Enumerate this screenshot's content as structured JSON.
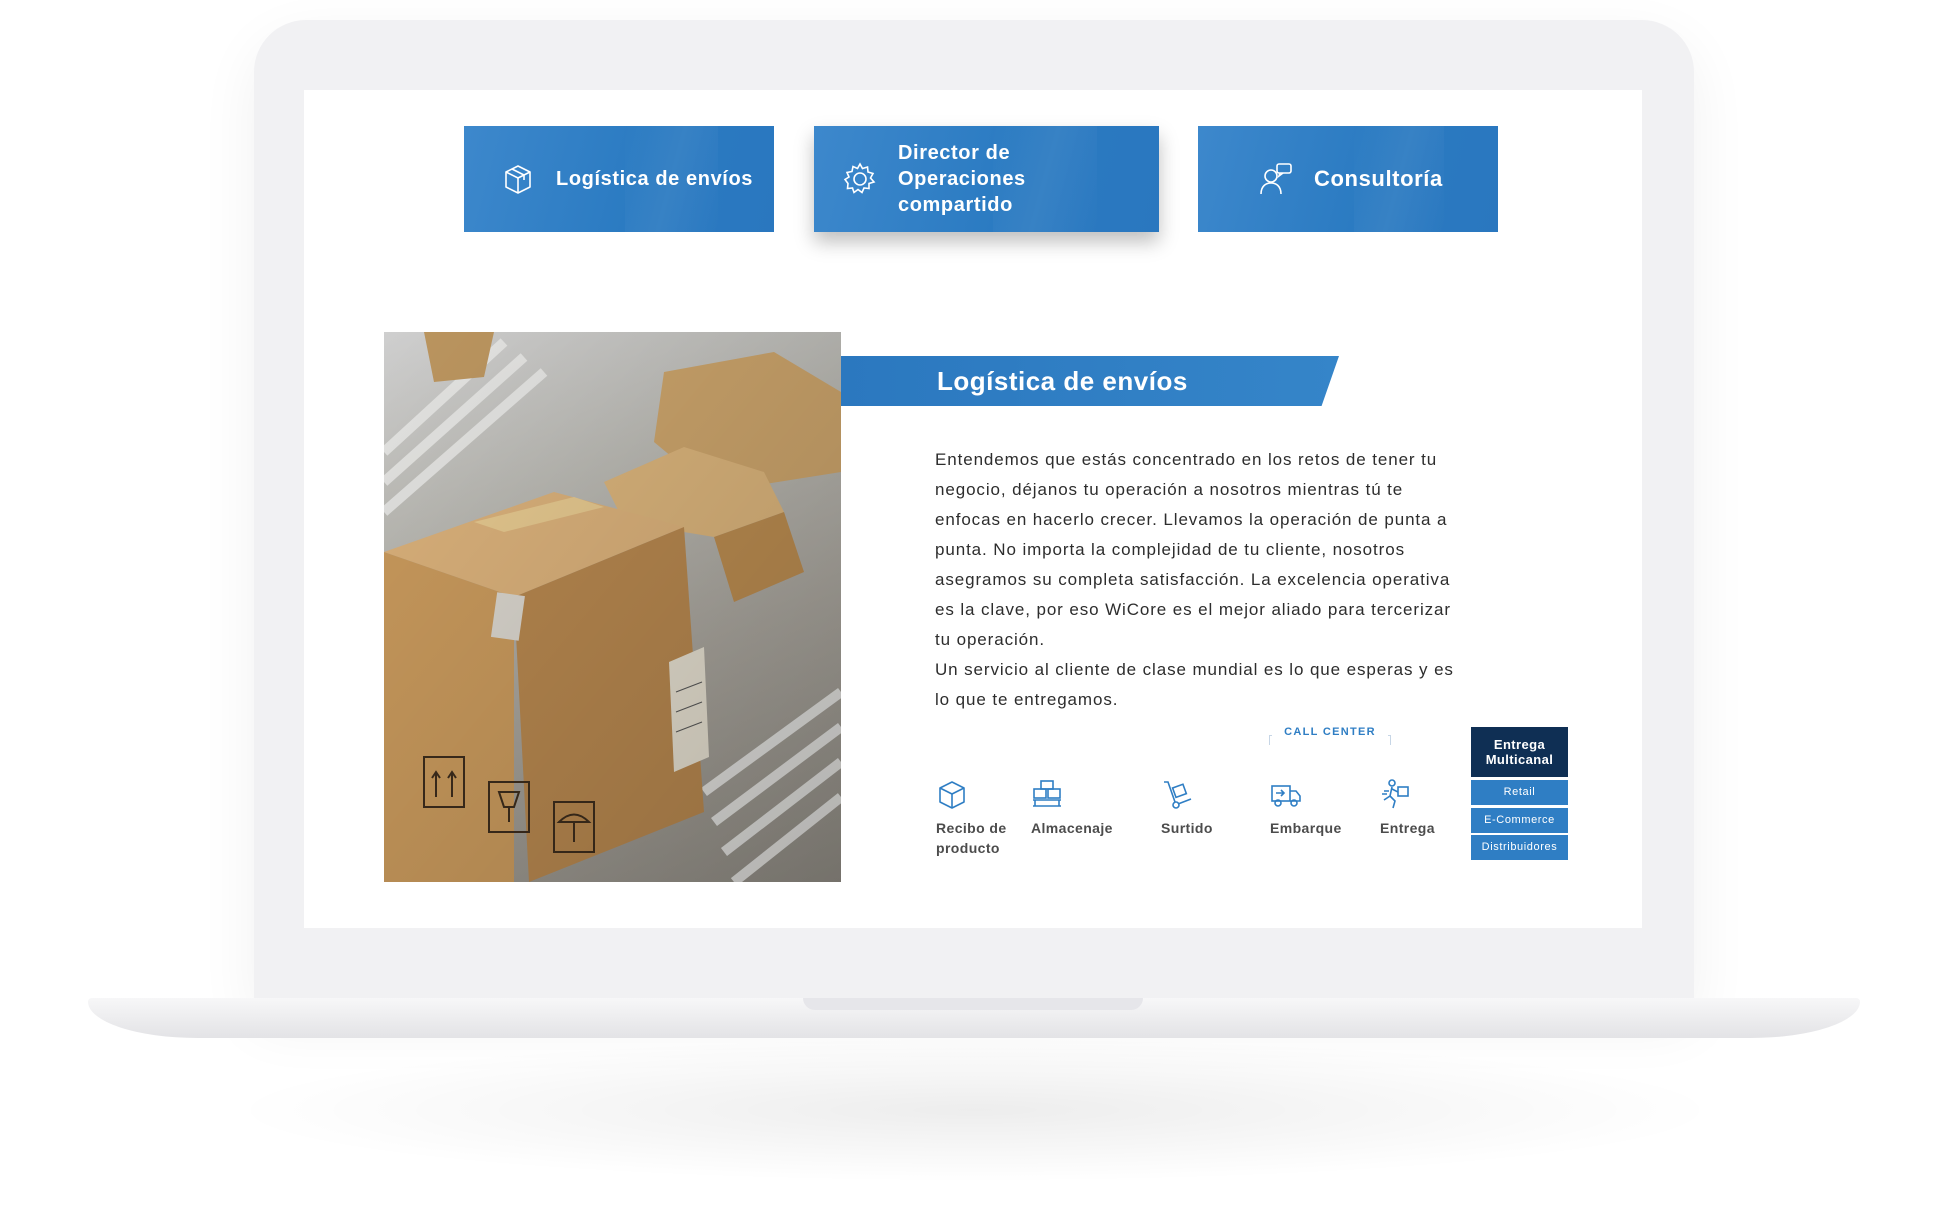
{
  "colors": {
    "tab_blue": "#2b7bc2",
    "dark_navy": "#0f2f54",
    "icon_blue": "#2f7ec4",
    "text": "#2d2d2d"
  },
  "tabs": [
    {
      "label": "Logística de envíos",
      "icon": "box-icon",
      "active": false
    },
    {
      "label": "Director de Operaciones compartido",
      "icon": "gear-icon",
      "active": true
    },
    {
      "label": "Consultoría",
      "icon": "consultant-icon",
      "active": false
    }
  ],
  "section": {
    "title": "Logística de envíos",
    "photo": "cardboard-boxes-on-conveyor",
    "paragraphs": [
      "Entendemos que estás concentrado en los retos de tener tu negocio, déjanos tu operación a nosotros mientras tú te enfocas en hacerlo crecer. Llevamos la operación de punta a punta. No importa la complejidad de tu cliente, nosotros asegramos su completa satisfacción. La excelencia operativa es la clave, por eso WiCore es el mejor aliado para tercerizar tu operación.",
      "Un servicio al cliente de clase mundial es lo que esperas y es lo que te entregamos."
    ]
  },
  "call_center": {
    "label": "CALL CENTER"
  },
  "steps": [
    {
      "label": "Recibo de producto",
      "icon": "box-icon"
    },
    {
      "label": "Almacenaje",
      "icon": "warehouse-icon"
    },
    {
      "label": "Surtido",
      "icon": "hand-truck-icon"
    },
    {
      "label": "Embarque",
      "icon": "truck-icon"
    },
    {
      "label": "Entrega",
      "icon": "delivery-person-icon"
    }
  ],
  "multichannel": {
    "title": "Entrega Multicanal",
    "items": [
      "Retail",
      "E-Commerce",
      "Distribuidores"
    ]
  }
}
